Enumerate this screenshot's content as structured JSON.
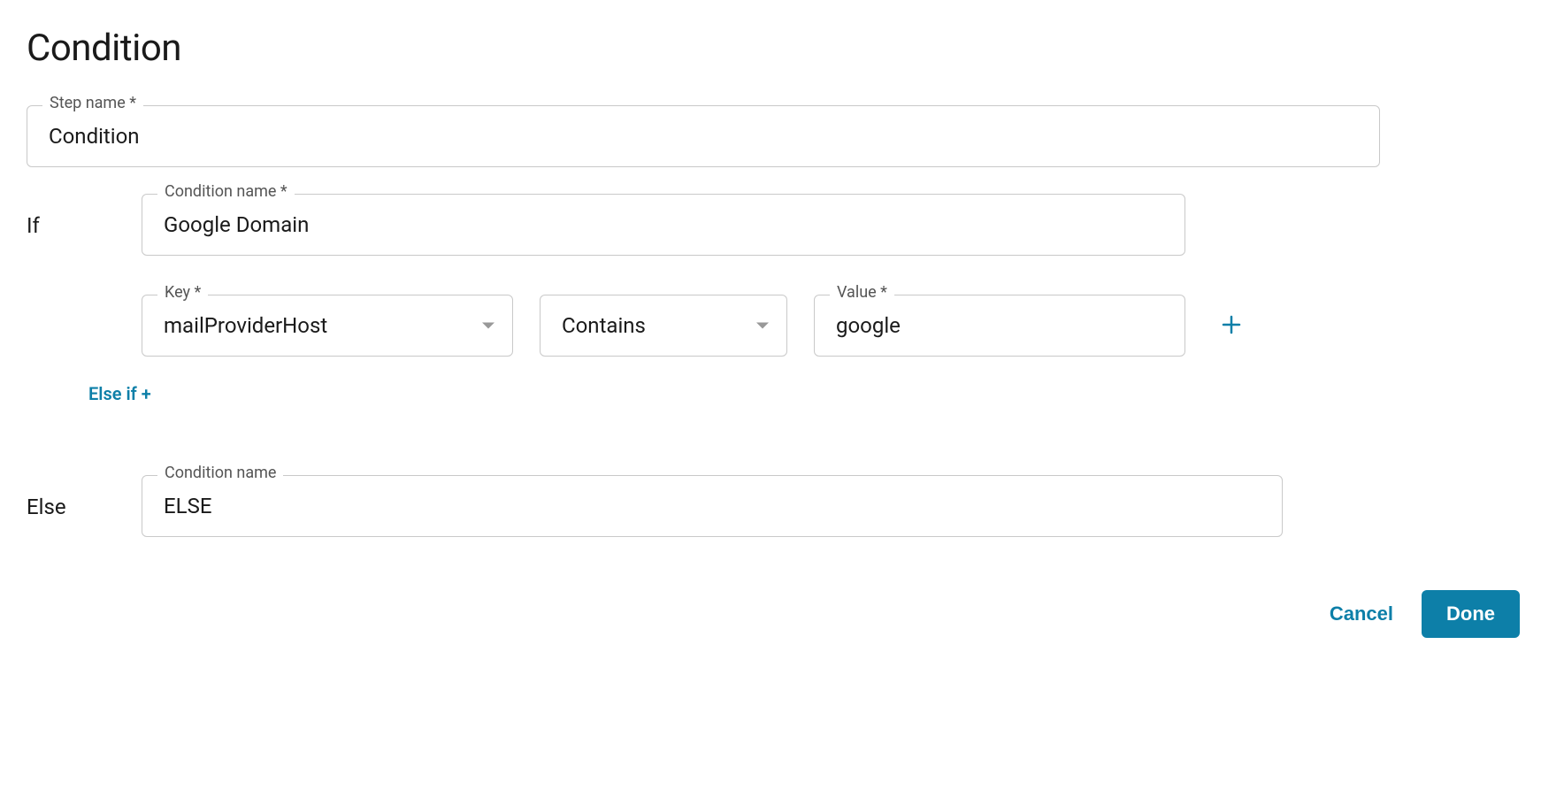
{
  "header": {
    "title": "Condition"
  },
  "fields": {
    "step_name": {
      "label": "Step name *",
      "value": "Condition"
    },
    "if_label": "If",
    "condition_name": {
      "label": "Condition name *",
      "value": "Google Domain"
    },
    "key": {
      "label": "Key *",
      "value": "mailProviderHost"
    },
    "operator": {
      "value": "Contains"
    },
    "value_field": {
      "label": "Value *",
      "value": "google"
    },
    "else_if_link": "Else if +",
    "else_label": "Else",
    "else_condition_name": {
      "label": "Condition name",
      "value": "ELSE"
    }
  },
  "actions": {
    "cancel": "Cancel",
    "done": "Done"
  }
}
